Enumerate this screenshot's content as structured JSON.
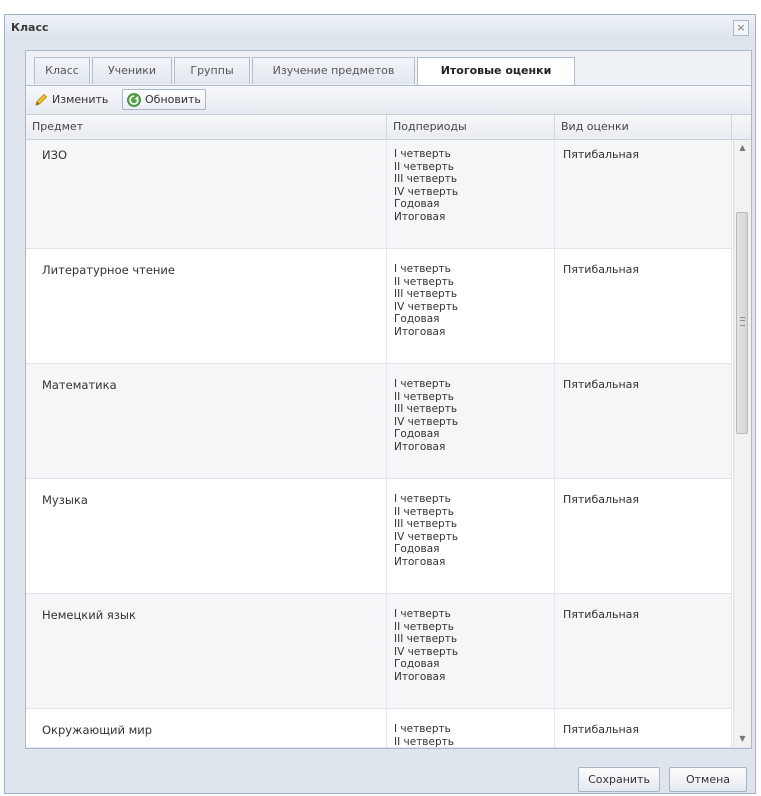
{
  "window": {
    "title": "Класс",
    "close_symbol": "×"
  },
  "tabs": [
    {
      "label": "Класс",
      "active": false
    },
    {
      "label": "Ученики",
      "active": false
    },
    {
      "label": "Группы",
      "active": false
    },
    {
      "label": "Изучение предметов",
      "active": false
    },
    {
      "label": "Итоговые оценки",
      "active": true
    }
  ],
  "toolbar": {
    "edit_label": "Изменить",
    "edit_icon": "pencil-icon",
    "refresh_label": "Обновить",
    "refresh_icon": "refresh-icon"
  },
  "grid": {
    "columns": [
      "Предмет",
      "Подпериоды",
      "Вид оценки"
    ],
    "rows": [
      {
        "subject": "ИЗО",
        "periods": [
          "I четверть",
          "II четверть",
          "III четверть",
          "IV четверть",
          "Годовая",
          "Итоговая"
        ],
        "grade_type": "Пятибальная"
      },
      {
        "subject": "Литературное чтение",
        "periods": [
          "I четверть",
          "II четверть",
          "III четверть",
          "IV четверть",
          "Годовая",
          "Итоговая"
        ],
        "grade_type": "Пятибальная"
      },
      {
        "subject": "Математика",
        "periods": [
          "I четверть",
          "II четверть",
          "III четверть",
          "IV четверть",
          "Годовая",
          "Итоговая"
        ],
        "grade_type": "Пятибальная"
      },
      {
        "subject": "Музыка",
        "periods": [
          "I четверть",
          "II четверть",
          "III четверть",
          "IV четверть",
          "Годовая",
          "Итоговая"
        ],
        "grade_type": "Пятибальная"
      },
      {
        "subject": "Немецкий язык",
        "periods": [
          "I четверть",
          "II четверть",
          "III четверть",
          "IV четверть",
          "Годовая",
          "Итоговая"
        ],
        "grade_type": "Пятибальная"
      },
      {
        "subject": "Окружающий мир",
        "periods": [
          "I четверть",
          "II четверть"
        ],
        "grade_type": "Пятибальная"
      }
    ]
  },
  "scrollbar": {
    "up": "▲",
    "down": "▼"
  },
  "footer": {
    "save_label": "Сохранить",
    "cancel_label": "Отмена"
  }
}
